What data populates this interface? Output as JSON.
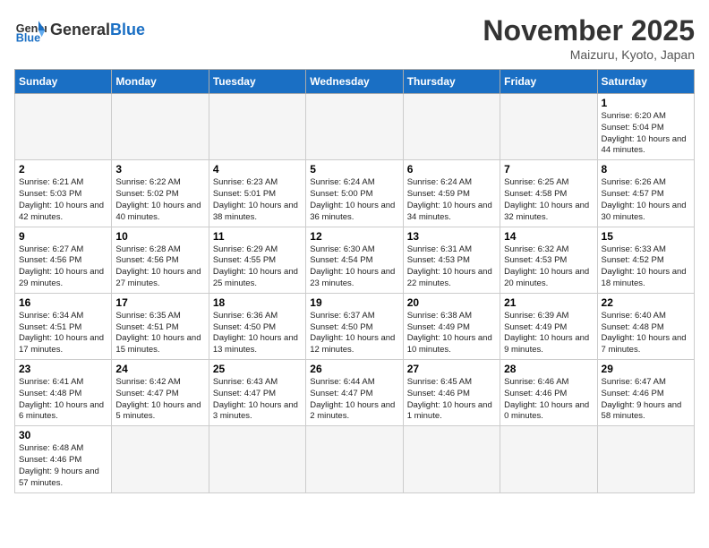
{
  "header": {
    "logo_general": "General",
    "logo_blue": "Blue",
    "title": "November 2025",
    "subtitle": "Maizuru, Kyoto, Japan"
  },
  "weekdays": [
    "Sunday",
    "Monday",
    "Tuesday",
    "Wednesday",
    "Thursday",
    "Friday",
    "Saturday"
  ],
  "weeks": [
    [
      {
        "day": "",
        "info": "",
        "empty": true
      },
      {
        "day": "",
        "info": "",
        "empty": true
      },
      {
        "day": "",
        "info": "",
        "empty": true
      },
      {
        "day": "",
        "info": "",
        "empty": true
      },
      {
        "day": "",
        "info": "",
        "empty": true
      },
      {
        "day": "",
        "info": "",
        "empty": true
      },
      {
        "day": "1",
        "info": "Sunrise: 6:20 AM\nSunset: 5:04 PM\nDaylight: 10 hours and 44 minutes."
      }
    ],
    [
      {
        "day": "2",
        "info": "Sunrise: 6:21 AM\nSunset: 5:03 PM\nDaylight: 10 hours and 42 minutes."
      },
      {
        "day": "3",
        "info": "Sunrise: 6:22 AM\nSunset: 5:02 PM\nDaylight: 10 hours and 40 minutes."
      },
      {
        "day": "4",
        "info": "Sunrise: 6:23 AM\nSunset: 5:01 PM\nDaylight: 10 hours and 38 minutes."
      },
      {
        "day": "5",
        "info": "Sunrise: 6:24 AM\nSunset: 5:00 PM\nDaylight: 10 hours and 36 minutes."
      },
      {
        "day": "6",
        "info": "Sunrise: 6:24 AM\nSunset: 4:59 PM\nDaylight: 10 hours and 34 minutes."
      },
      {
        "day": "7",
        "info": "Sunrise: 6:25 AM\nSunset: 4:58 PM\nDaylight: 10 hours and 32 minutes."
      },
      {
        "day": "8",
        "info": "Sunrise: 6:26 AM\nSunset: 4:57 PM\nDaylight: 10 hours and 30 minutes."
      }
    ],
    [
      {
        "day": "9",
        "info": "Sunrise: 6:27 AM\nSunset: 4:56 PM\nDaylight: 10 hours and 29 minutes."
      },
      {
        "day": "10",
        "info": "Sunrise: 6:28 AM\nSunset: 4:56 PM\nDaylight: 10 hours and 27 minutes."
      },
      {
        "day": "11",
        "info": "Sunrise: 6:29 AM\nSunset: 4:55 PM\nDaylight: 10 hours and 25 minutes."
      },
      {
        "day": "12",
        "info": "Sunrise: 6:30 AM\nSunset: 4:54 PM\nDaylight: 10 hours and 23 minutes."
      },
      {
        "day": "13",
        "info": "Sunrise: 6:31 AM\nSunset: 4:53 PM\nDaylight: 10 hours and 22 minutes."
      },
      {
        "day": "14",
        "info": "Sunrise: 6:32 AM\nSunset: 4:53 PM\nDaylight: 10 hours and 20 minutes."
      },
      {
        "day": "15",
        "info": "Sunrise: 6:33 AM\nSunset: 4:52 PM\nDaylight: 10 hours and 18 minutes."
      }
    ],
    [
      {
        "day": "16",
        "info": "Sunrise: 6:34 AM\nSunset: 4:51 PM\nDaylight: 10 hours and 17 minutes."
      },
      {
        "day": "17",
        "info": "Sunrise: 6:35 AM\nSunset: 4:51 PM\nDaylight: 10 hours and 15 minutes."
      },
      {
        "day": "18",
        "info": "Sunrise: 6:36 AM\nSunset: 4:50 PM\nDaylight: 10 hours and 13 minutes."
      },
      {
        "day": "19",
        "info": "Sunrise: 6:37 AM\nSunset: 4:50 PM\nDaylight: 10 hours and 12 minutes."
      },
      {
        "day": "20",
        "info": "Sunrise: 6:38 AM\nSunset: 4:49 PM\nDaylight: 10 hours and 10 minutes."
      },
      {
        "day": "21",
        "info": "Sunrise: 6:39 AM\nSunset: 4:49 PM\nDaylight: 10 hours and 9 minutes."
      },
      {
        "day": "22",
        "info": "Sunrise: 6:40 AM\nSunset: 4:48 PM\nDaylight: 10 hours and 7 minutes."
      }
    ],
    [
      {
        "day": "23",
        "info": "Sunrise: 6:41 AM\nSunset: 4:48 PM\nDaylight: 10 hours and 6 minutes."
      },
      {
        "day": "24",
        "info": "Sunrise: 6:42 AM\nSunset: 4:47 PM\nDaylight: 10 hours and 5 minutes."
      },
      {
        "day": "25",
        "info": "Sunrise: 6:43 AM\nSunset: 4:47 PM\nDaylight: 10 hours and 3 minutes."
      },
      {
        "day": "26",
        "info": "Sunrise: 6:44 AM\nSunset: 4:47 PM\nDaylight: 10 hours and 2 minutes."
      },
      {
        "day": "27",
        "info": "Sunrise: 6:45 AM\nSunset: 4:46 PM\nDaylight: 10 hours and 1 minute."
      },
      {
        "day": "28",
        "info": "Sunrise: 6:46 AM\nSunset: 4:46 PM\nDaylight: 10 hours and 0 minutes."
      },
      {
        "day": "29",
        "info": "Sunrise: 6:47 AM\nSunset: 4:46 PM\nDaylight: 9 hours and 58 minutes."
      }
    ],
    [
      {
        "day": "30",
        "info": "Sunrise: 6:48 AM\nSunset: 4:46 PM\nDaylight: 9 hours and 57 minutes."
      },
      {
        "day": "",
        "info": "",
        "empty": true
      },
      {
        "day": "",
        "info": "",
        "empty": true
      },
      {
        "day": "",
        "info": "",
        "empty": true
      },
      {
        "day": "",
        "info": "",
        "empty": true
      },
      {
        "day": "",
        "info": "",
        "empty": true
      },
      {
        "day": "",
        "info": "",
        "empty": true
      }
    ]
  ]
}
